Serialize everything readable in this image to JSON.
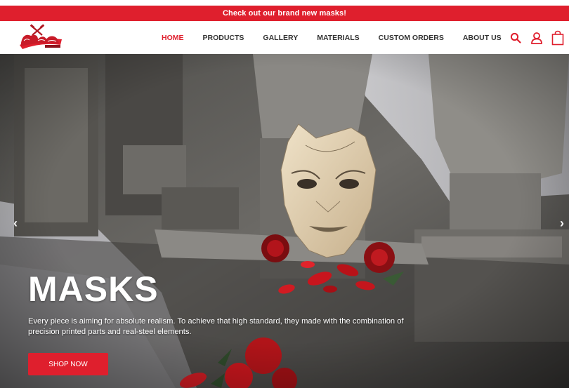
{
  "announcement": {
    "text": "Check out our brand new masks!"
  },
  "header": {
    "logo_alt": "Dante's Workshop",
    "nav": [
      {
        "label": "HOME",
        "active": true
      },
      {
        "label": "PRODUCTS",
        "active": false
      },
      {
        "label": "GALLERY",
        "active": false
      },
      {
        "label": "MATERIALS",
        "active": false
      },
      {
        "label": "CUSTOM ORDERS",
        "active": false
      },
      {
        "label": "ABOUT US",
        "active": false
      }
    ],
    "icons": [
      "search-icon",
      "user-icon",
      "cart-icon"
    ]
  },
  "hero": {
    "title": "MASKS",
    "description": "Every piece is aiming for absolute realism. To achieve that high standard, they made with the combination of precision printed parts and real-steel elements.",
    "button_label": "SHOP NOW",
    "prev_arrow": "‹",
    "next_arrow": "›"
  },
  "colors": {
    "brand_red": "#df1f2d",
    "nav_text": "#333333",
    "white": "#ffffff"
  }
}
